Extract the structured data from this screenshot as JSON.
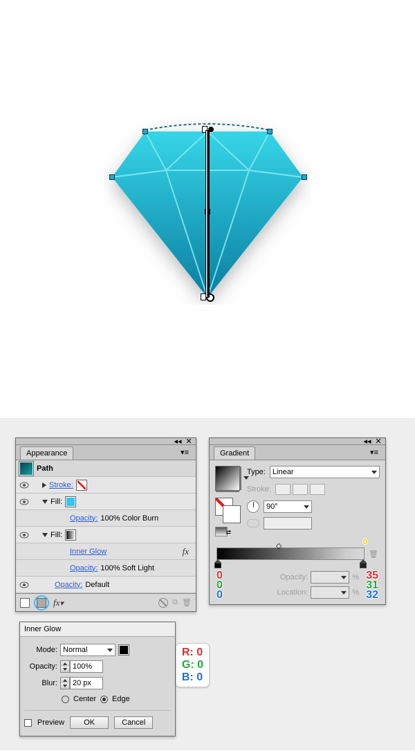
{
  "canvas": {
    "shadow": true
  },
  "appearance": {
    "title": "Appearance",
    "object": "Path",
    "rows": [
      {
        "label": "Stroke:",
        "kind": "stroke-none"
      },
      {
        "label": "Fill:",
        "kind": "fill-cyan"
      },
      {
        "label": "Opacity:",
        "value": "100% Color Burn",
        "sub": true,
        "link": true
      },
      {
        "label": "Fill:",
        "kind": "fill-grad"
      },
      {
        "label": "Inner Glow",
        "sub": true,
        "link": true,
        "fx": true
      },
      {
        "label": "Opacity:",
        "value": "100% Soft Light",
        "sub": true,
        "link": true
      },
      {
        "label": "Opacity:",
        "value": "Default",
        "link": true
      }
    ]
  },
  "gradient": {
    "title": "Gradient",
    "type_label": "Type:",
    "type_value": "Linear",
    "stroke_label": "Stroke:",
    "angle_value": "90°",
    "opacity_label": "Opacity:",
    "location_label": "Location:",
    "right_stop_label_top": "0",
    "left_rgb": {
      "r": "0",
      "g": "0",
      "b": "0"
    },
    "right_rgb": {
      "r": "35",
      "g": "31",
      "b": "32"
    }
  },
  "inner_glow": {
    "title": "Inner Glow",
    "mode_label": "Mode:",
    "mode_value": "Normal",
    "opacity_label": "Opacity:",
    "opacity_value": "100%",
    "blur_label": "Blur:",
    "blur_value": "20 px",
    "center_label": "Center",
    "edge_label": "Edge",
    "preview_label": "Preview",
    "ok": "OK",
    "cancel": "Cancel",
    "color": {
      "r": "R: 0",
      "g": "G: 0",
      "b": "B: 0"
    }
  },
  "chart_data": {
    "type": "table",
    "note": "no chart"
  }
}
